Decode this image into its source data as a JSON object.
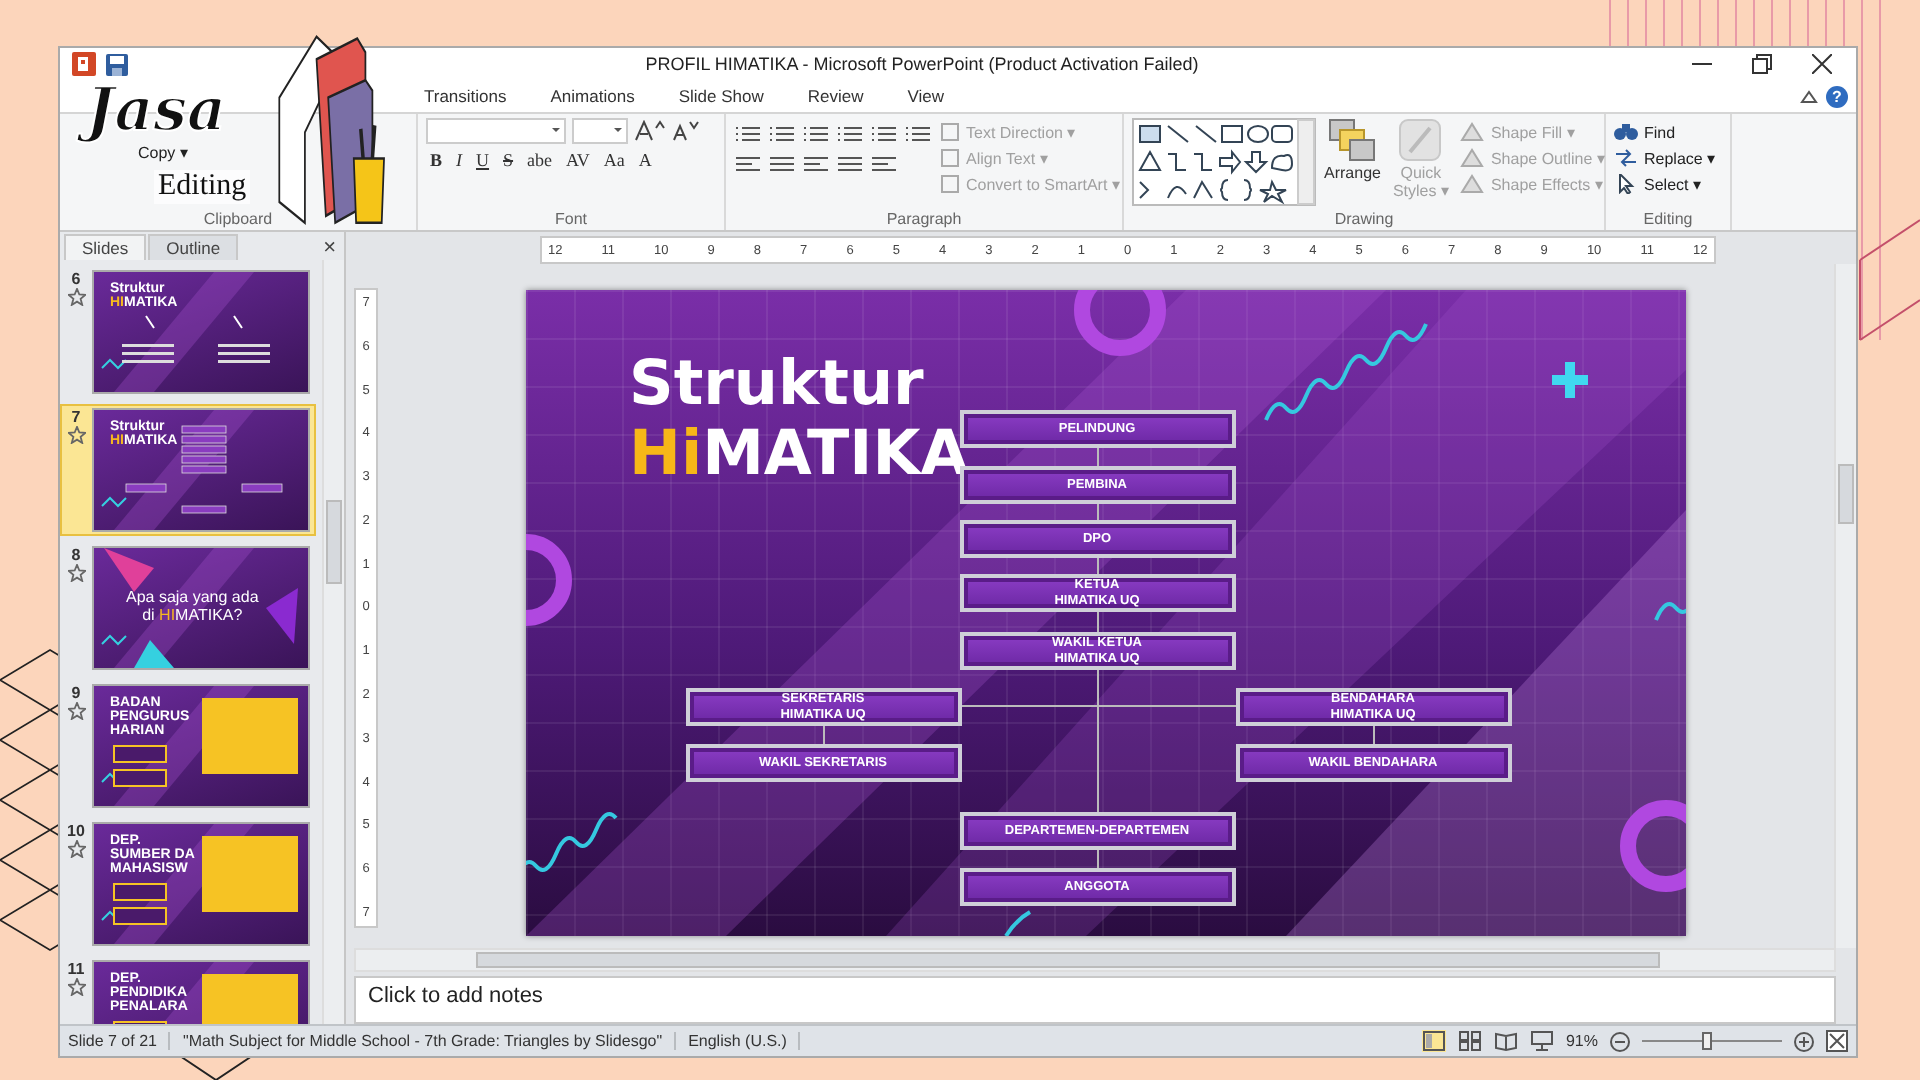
{
  "window": {
    "title": "PROFIL HIMATIKA  -  Microsoft PowerPoint (Product Activation Failed)",
    "help": "?"
  },
  "logo": {
    "line_1": "Jasa",
    "line_2": "Editing"
  },
  "ribbon": {
    "tabs": [
      {
        "label": "Transitions",
        "selected": false
      },
      {
        "label": "Animations",
        "selected": false
      },
      {
        "label": "Slide Show",
        "selected": false
      },
      {
        "label": "Review",
        "selected": false
      },
      {
        "label": "View",
        "selected": false
      }
    ],
    "clipboard": {
      "label": "Clipboard",
      "commands": [
        {
          "label": "Copy ▾",
          "disabled": false
        }
      ]
    },
    "font": {
      "label": "Font",
      "buttons": [
        "B",
        "I",
        "U",
        "S",
        "abe",
        "AV",
        "Aa",
        "A"
      ]
    },
    "paragraph": {
      "label": "Paragraph",
      "commands": [
        {
          "label": "Text Direction ▾",
          "disabled": true
        },
        {
          "label": "Align Text ▾",
          "disabled": true
        },
        {
          "label": "Convert to SmartArt ▾",
          "disabled": true
        }
      ]
    },
    "drawing": {
      "label": "Drawing",
      "arrange": "Arrange",
      "quick_styles": "Quick Styles ▾",
      "commands": [
        {
          "label": "Shape Fill ▾",
          "disabled": true
        },
        {
          "label": "Shape Outline ▾",
          "disabled": true
        },
        {
          "label": "Shape Effects ▾",
          "disabled": true
        }
      ]
    },
    "editing": {
      "label": "Editing",
      "commands": [
        {
          "label": "Find",
          "disabled": false
        },
        {
          "label": "Replace ▾",
          "disabled": false
        },
        {
          "label": "Select ▾",
          "disabled": false
        }
      ]
    }
  },
  "slide_pane": {
    "tabs": [
      {
        "label": "Slides",
        "selected": true
      },
      {
        "label": "Outline",
        "selected": false
      }
    ],
    "close": "×",
    "thumbnails": [
      {
        "number": "6",
        "selected": false,
        "kind": "columns",
        "lines": [
          [
            {
              "text": "Struktur",
              "highlight": false
            }
          ],
          [
            {
              "text": "HI",
              "highlight": true
            },
            {
              "text": "MATIKA",
              "highlight": false
            }
          ]
        ]
      },
      {
        "number": "7",
        "selected": true,
        "kind": "chart",
        "lines": [
          [
            {
              "text": "Struktur",
              "highlight": false
            }
          ],
          [
            {
              "text": "HI",
              "highlight": true
            },
            {
              "text": "MATIKA",
              "highlight": false
            }
          ]
        ]
      },
      {
        "number": "8",
        "selected": false,
        "kind": "question",
        "lines": [
          [
            {
              "text": "Apa saja yang ada",
              "highlight": false
            }
          ],
          [
            {
              "text": "di ",
              "highlight": false
            },
            {
              "text": "HI",
              "highlight": true
            },
            {
              "text": "MATIKA?",
              "highlight": false
            }
          ]
        ]
      },
      {
        "number": "9",
        "selected": false,
        "kind": "cards",
        "lines": [
          [
            {
              "text": "BADAN",
              "highlight": false
            }
          ],
          [
            {
              "text": "PENGURUS",
              "highlight": false
            }
          ],
          [
            {
              "text": "HARIAN",
              "highlight": false
            }
          ]
        ]
      },
      {
        "number": "10",
        "selected": false,
        "kind": "cards",
        "lines": [
          [
            {
              "text": "DEP.",
              "highlight": false
            }
          ],
          [
            {
              "text": "SUMBER DA",
              "highlight": false
            }
          ],
          [
            {
              "text": "MAHASISW",
              "highlight": false
            }
          ]
        ]
      },
      {
        "number": "11",
        "selected": false,
        "kind": "cards",
        "lines": [
          [
            {
              "text": "DEP.",
              "highlight": false
            }
          ],
          [
            {
              "text": "PENDIDIKA",
              "highlight": false
            }
          ],
          [
            {
              "text": "PENALARA",
              "highlight": false
            }
          ]
        ]
      }
    ]
  },
  "horizontal_ruler": [
    "12",
    "11",
    "10",
    "9",
    "8",
    "7",
    "6",
    "5",
    "4",
    "3",
    "2",
    "1",
    "0",
    "1",
    "2",
    "3",
    "4",
    "5",
    "6",
    "7",
    "8",
    "9",
    "10",
    "11",
    "12"
  ],
  "vertical_ruler": [
    "7",
    "6",
    "5",
    "4",
    "3",
    "2",
    "1",
    "0",
    "1",
    "2",
    "3",
    "4",
    "5",
    "6",
    "7"
  ],
  "slide": {
    "title_lines": [
      [
        {
          "text": "Struktur",
          "highlight": false
        }
      ],
      [
        {
          "text": "Hi",
          "highlight": true
        },
        {
          "text": "MATIKA",
          "highlight": false
        }
      ]
    ],
    "nodes": [
      {
        "lines": [
          "PELINDUNG"
        ],
        "kind": "center"
      },
      {
        "lines": [
          "PEMBINA"
        ],
        "kind": "center"
      },
      {
        "lines": [
          "DPO"
        ],
        "kind": "center"
      },
      {
        "lines": [
          "KETUA",
          "HIMATIKA UQ"
        ],
        "kind": "center"
      },
      {
        "lines": [
          "WAKIL KETUA",
          "HIMATIKA UQ"
        ],
        "kind": "center"
      },
      {
        "lines": [
          "SEKRETARIS",
          "HIMATIKA UQ"
        ],
        "kind": "left"
      },
      {
        "lines": [
          "BENDAHARA",
          "HIMATIKA UQ"
        ],
        "kind": "right"
      },
      {
        "lines": [
          "WAKIL SEKRETARIS"
        ],
        "kind": "left"
      },
      {
        "lines": [
          "WAKIL BENDAHARA"
        ],
        "kind": "right"
      },
      {
        "lines": [
          "DEPARTEMEN-DEPARTEMEN"
        ],
        "kind": "center"
      },
      {
        "lines": [
          "ANGGOTA"
        ],
        "kind": "center"
      }
    ]
  },
  "notes": {
    "placeholder": "Click to add notes"
  },
  "status_bar": {
    "slide": "Slide 7 of 21",
    "theme": "\"Math Subject for Middle School - 7th Grade: Triangles by Slidesgo\"",
    "language": "English (U.S.)",
    "zoom": "91%",
    "zoom_slider": {
      "level": 0.47
    }
  }
}
